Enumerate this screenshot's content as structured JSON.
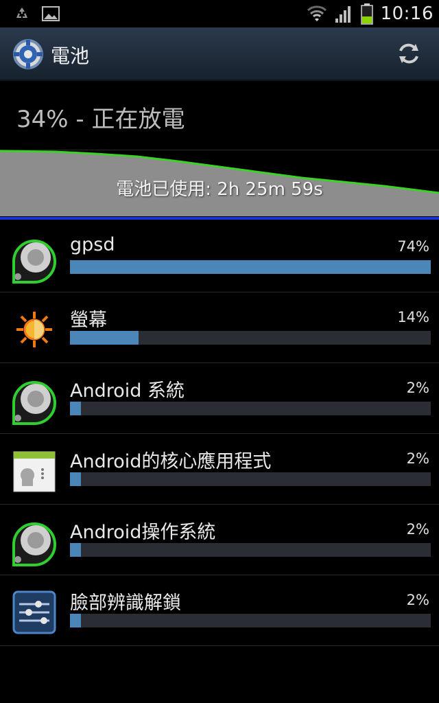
{
  "status_bar": {
    "time": "10:16",
    "icons": [
      "recycle-icon",
      "image-icon",
      "wifi-icon",
      "signal-icon",
      "battery-icon"
    ],
    "battery_level_pct": 34
  },
  "title_bar": {
    "title": "電池",
    "icons": [
      "settings-icon",
      "refresh-icon"
    ]
  },
  "summary": {
    "text": "34% - 正在放電"
  },
  "graph": {
    "label": "電池已使用: 2h 25m 59s",
    "line_color": "#3cd22a",
    "fill_color": "#8d8d8d"
  },
  "usage_items": [
    {
      "name": "gpsd",
      "percent_label": "74%",
      "percent": 74,
      "icon": "android-system-icon"
    },
    {
      "name": "螢幕",
      "percent_label": "14%",
      "percent": 14,
      "icon": "brightness-icon"
    },
    {
      "name": "Android 系統",
      "percent_label": "2%",
      "percent": 2,
      "icon": "android-system-icon"
    },
    {
      "name": "Android的核心應用程式",
      "percent_label": "2%",
      "percent": 2,
      "icon": "android-core-apps-icon"
    },
    {
      "name": "Android操作系統",
      "percent_label": "2%",
      "percent": 2,
      "icon": "android-system-icon"
    },
    {
      "name": "臉部辨識解鎖",
      "percent_label": "2%",
      "percent": 2,
      "icon": "face-unlock-settings-icon"
    }
  ],
  "colors": {
    "bar_fill": "#4a86b8",
    "bar_track": "#2a2d34",
    "accent_blue": "#1a33d6"
  }
}
